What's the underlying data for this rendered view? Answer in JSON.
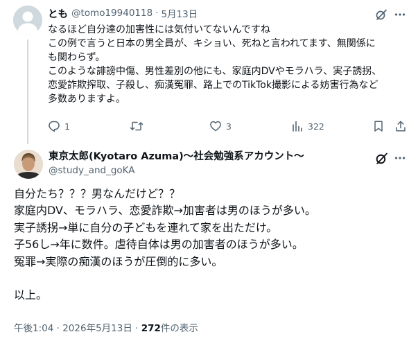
{
  "reply": {
    "display_name": "とも",
    "handle": "@tomo19940118",
    "separator": "·",
    "date": "5月13日",
    "text_lines": [
      "なるほど自分達の加害性には気付いてないんですね",
      "この例で言うと日本の男全員が、キショい、死ねと言われてます、無関係に",
      "も関わらず。",
      "このような誹謗中傷、男性差別の他にも、家庭内DVやモラハラ、実子誘拐、",
      "恋愛詐欺搾取、子殺し、痴漢冤罪、路上でのTikTok撮影による妨害行為など",
      "多数ありますよ。"
    ],
    "reply_count": "1",
    "repost_count": "",
    "like_count": "3",
    "view_count": "322"
  },
  "main": {
    "display_name": "東京太郎(Kyotaro Azuma)〜社会勉強系アカウント〜",
    "handle": "@study_and_goKA",
    "text_lines": [
      "自分たち？？？男なんだけど？？",
      "家庭内DV、モラハラ、恋愛詐欺→加害者は男のほうが多い。",
      "実子誘拐→単に自分の子どもを連れて家を出ただけ。",
      "子56し→年に数件。虐待自体は男の加害者のほうが多い。",
      "冤罪→実際の痴漢のほうが圧倒的に多い。",
      "",
      "以上。"
    ],
    "meta": {
      "time": "午後1:04",
      "sep1": "·",
      "date": "2026年5月13日",
      "sep2": "·",
      "views": "272",
      "views_label": "件の表示"
    }
  },
  "icons": {
    "grok": "grok-slash-icon",
    "more": "more-dots-icon",
    "reply": "reply-bubble-icon",
    "repost": "repost-arrows-icon",
    "like": "heart-icon",
    "views": "bar-chart-icon",
    "bookmark": "bookmark-icon",
    "share": "share-upload-icon"
  },
  "colors": {
    "text": "#0f1419",
    "secondary": "#536471",
    "thread_line": "#cfd9de",
    "background": "#ffffff"
  }
}
